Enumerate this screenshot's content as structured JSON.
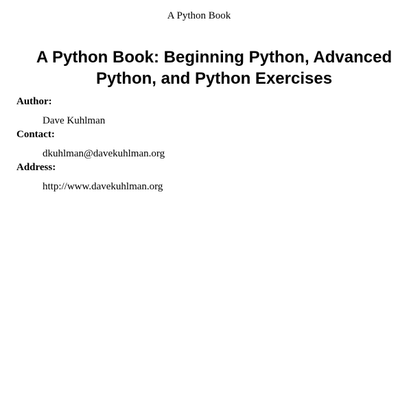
{
  "header": {
    "running_title": "A Python Book"
  },
  "document": {
    "title": "A Python Book: Beginning Python, Advanced Python, and Python Exercises",
    "fields": [
      {
        "name": "Author:",
        "value": "Dave Kuhlman"
      },
      {
        "name": "Contact:",
        "value": "dkuhlman@davekuhlman.org"
      },
      {
        "name": "Address:",
        "value": "http://www.davekuhlman.org"
      }
    ]
  }
}
